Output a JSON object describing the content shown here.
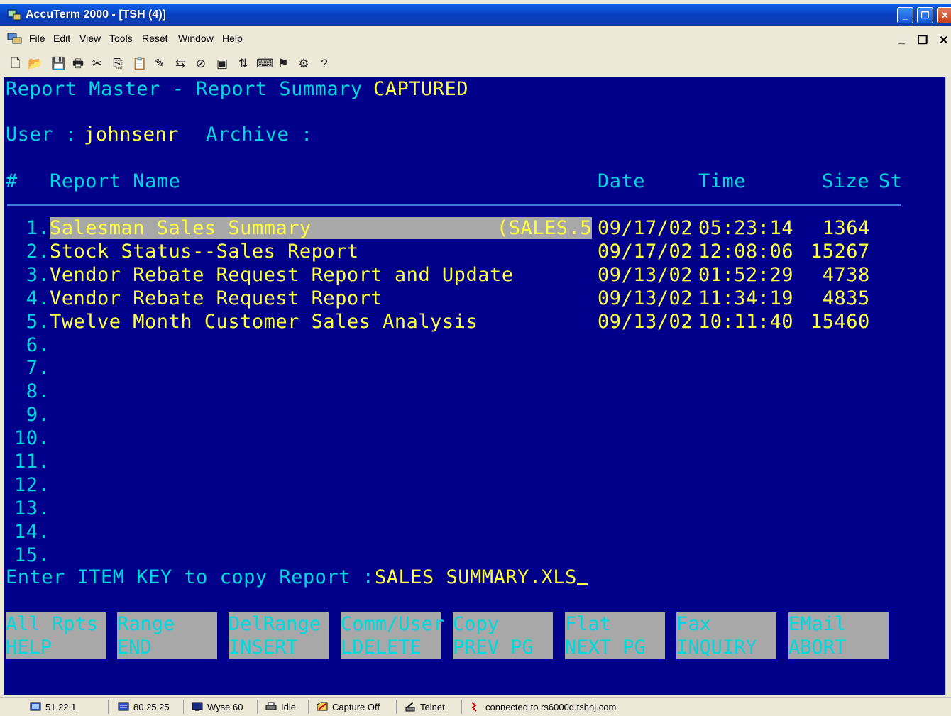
{
  "window": {
    "title": "AccuTerm 2000 - [TSH (4)]",
    "title_controls": [
      "_",
      "❐",
      "✕"
    ]
  },
  "menubar": {
    "items": [
      "File",
      "Edit",
      "View",
      "Tools",
      "Reset",
      "Window",
      "Help"
    ],
    "mdi_controls": [
      "_",
      "❐",
      "✕"
    ]
  },
  "toolbar": {
    "icons": [
      "new-icon",
      "open-icon",
      "save-icon",
      "print-icon",
      "cut-icon",
      "copy-icon",
      "paste-icon",
      "edit-icon",
      "connect-icon",
      "disconnect-icon",
      "capture-icon",
      "transfer-icon",
      "keyboard-icon",
      "macro-icon",
      "settings-icon",
      "help-icon"
    ],
    "glyphs": [
      "🗋",
      "📂",
      "💾",
      "🖶",
      "✂",
      "⎘",
      "📋",
      "✎",
      "⇆",
      "⊘",
      "▣",
      "⇅",
      "⌨",
      "⚑",
      "⚙",
      "?"
    ]
  },
  "terminal": {
    "title_line": "Report Master - Report Summary",
    "mode": "CAPTURED",
    "user_label": "User : ",
    "user_value": "johnsenr",
    "archive_label": "Archive :",
    "headers": {
      "num": "#",
      "name": "Report Name",
      "date": "Date",
      "time": "Time",
      "size": "Size",
      "st": "St"
    },
    "rows": [
      {
        "num": " 1.",
        "name": "Salesman Sales Summary",
        "extra": "(SALES.5",
        "date": "09/17/02",
        "time": "05:23:14",
        "size": " 1364"
      },
      {
        "num": " 2.",
        "name": "Stock Status--Sales Report",
        "extra": "",
        "date": "09/17/02",
        "time": "12:08:06",
        "size": "15267"
      },
      {
        "num": " 3.",
        "name": "Vendor Rebate Request Report and Update",
        "extra": "",
        "date": "09/13/02",
        "time": "01:52:29",
        "size": " 4738"
      },
      {
        "num": " 4.",
        "name": "Vendor Rebate Request Report",
        "extra": "",
        "date": "09/13/02",
        "time": "11:34:19",
        "size": " 4835"
      },
      {
        "num": " 5.",
        "name": "Twelve Month Customer Sales Analysis",
        "extra": "",
        "date": "09/13/02",
        "time": "10:11:40",
        "size": "15460"
      },
      {
        "num": " 6.",
        "name": "",
        "extra": "",
        "date": "",
        "time": "",
        "size": ""
      },
      {
        "num": " 7.",
        "name": "",
        "extra": "",
        "date": "",
        "time": "",
        "size": ""
      },
      {
        "num": " 8.",
        "name": "",
        "extra": "",
        "date": "",
        "time": "",
        "size": ""
      },
      {
        "num": " 9.",
        "name": "",
        "extra": "",
        "date": "",
        "time": "",
        "size": ""
      },
      {
        "num": "10.",
        "name": "",
        "extra": "",
        "date": "",
        "time": "",
        "size": ""
      },
      {
        "num": "11.",
        "name": "",
        "extra": "",
        "date": "",
        "time": "",
        "size": ""
      },
      {
        "num": "12.",
        "name": "",
        "extra": "",
        "date": "",
        "time": "",
        "size": ""
      },
      {
        "num": "13.",
        "name": "",
        "extra": "",
        "date": "",
        "time": "",
        "size": ""
      },
      {
        "num": "14.",
        "name": "",
        "extra": "",
        "date": "",
        "time": "",
        "size": ""
      },
      {
        "num": "15.",
        "name": "",
        "extra": "",
        "date": "",
        "time": "",
        "size": ""
      }
    ],
    "prompt_label": "Enter ITEM KEY to copy Report : ",
    "prompt_value": "SALES SUMMARY.XLS",
    "function_keys": [
      {
        "top": "All Rpts",
        "bottom": "HELP"
      },
      {
        "top": "Range",
        "bottom": "END"
      },
      {
        "top": "DelRange",
        "bottom": "INSERT"
      },
      {
        "top": "Comm/User",
        "bottom": "LDELETE"
      },
      {
        "top": "Copy",
        "bottom": "PREV PG"
      },
      {
        "top": "Flat",
        "bottom": "NEXT PG"
      },
      {
        "top": "Fax",
        "bottom": "INQUIRY"
      },
      {
        "top": "EMail",
        "bottom": "ABORT"
      }
    ]
  },
  "statusbar": {
    "cursor_pos": "51,22,1",
    "screen_size": "80,25,25",
    "emulation": "Wyse 60",
    "printer": "Idle",
    "capture": "Capture Off",
    "protocol": "Telnet",
    "connection": "connected to rs6000d.tshnj.com"
  },
  "colors": {
    "terminal_bg": "#00008a",
    "cyan": "#00d8e0",
    "yellow": "#ffff44",
    "highlight": "#a8a8a8"
  }
}
